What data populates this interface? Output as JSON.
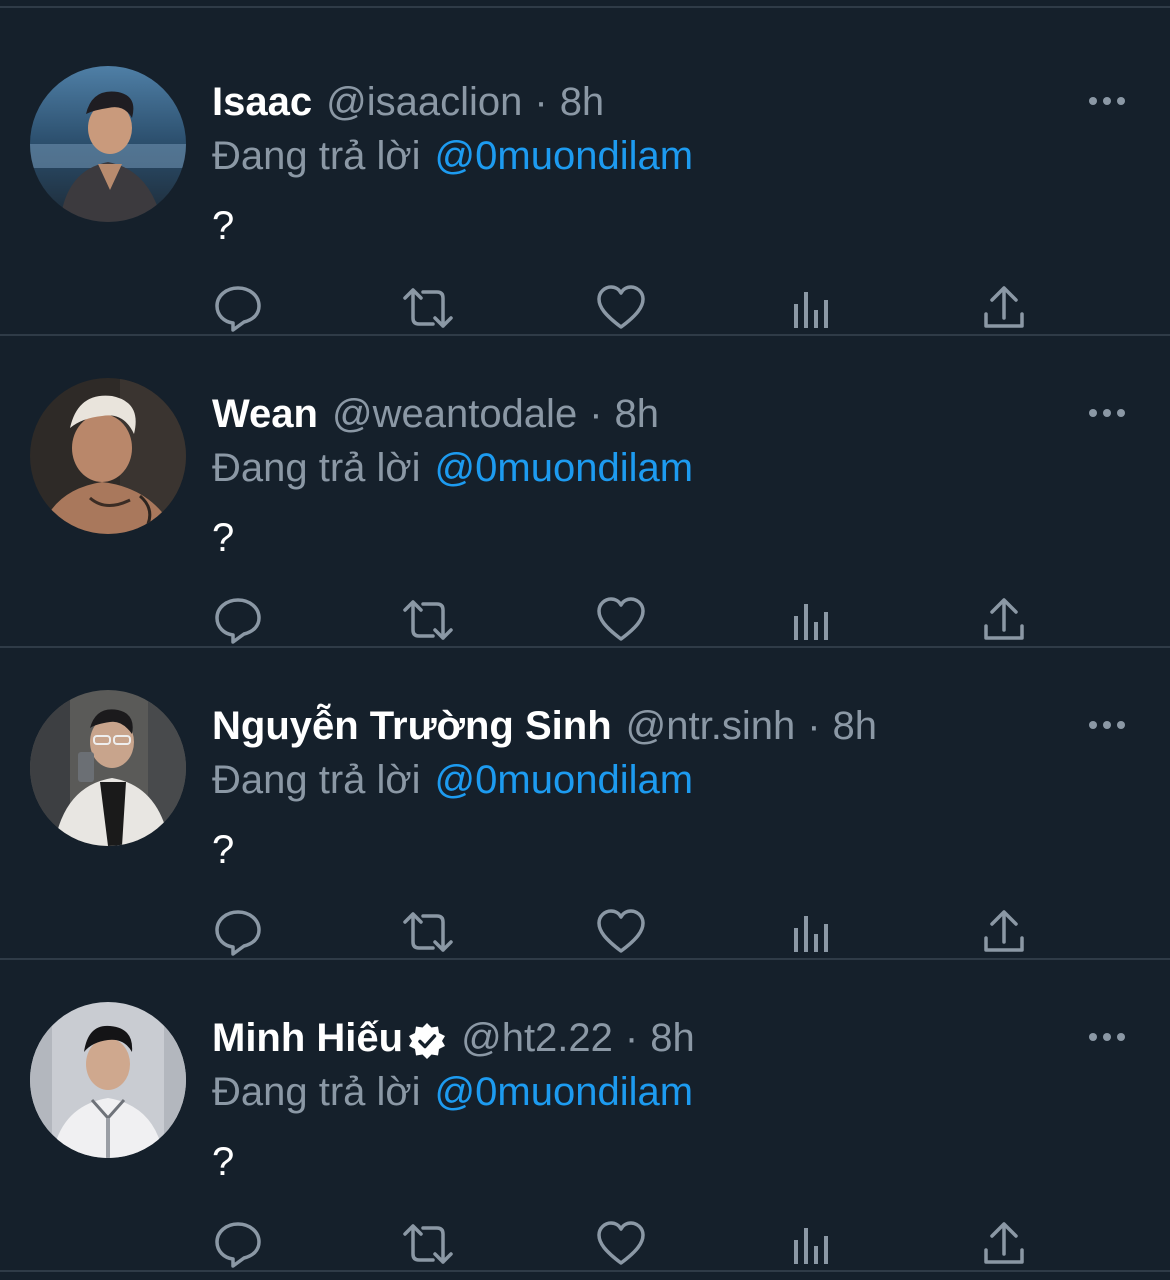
{
  "colors": {
    "background": "#15202b",
    "divider": "#2f3b47",
    "secondary_text": "#8b98a5",
    "mention": "#1d9bf0",
    "icon": "#8b98a5"
  },
  "tweets": [
    {
      "display_name": "Isaac",
      "handle": "@isaaclion",
      "dot": "·",
      "time": "8h",
      "verified": false,
      "reply_prefix": "Đang trả lời",
      "reply_mention": "@0muondilam",
      "text": "?"
    },
    {
      "display_name": "Wean",
      "handle": "@weantodale",
      "dot": "·",
      "time": "8h",
      "verified": false,
      "reply_prefix": "Đang trả lời",
      "reply_mention": "@0muondilam",
      "text": "?"
    },
    {
      "display_name": "Nguyễn Trường Sinh",
      "handle": "@ntr.sinh",
      "dot": "·",
      "time": "8h",
      "verified": false,
      "reply_prefix": "Đang trả lời",
      "reply_mention": "@0muondilam",
      "text": "?"
    },
    {
      "display_name": "Minh Hiếu",
      "handle": "@ht2.22",
      "dot": "·",
      "time": "8h",
      "verified": true,
      "reply_prefix": "Đang trả lời",
      "reply_mention": "@0muondilam",
      "text": "?"
    }
  ],
  "icons": {
    "more": "more-horizontal-icon",
    "reply": "reply-bubble-icon",
    "retweet": "retweet-icon",
    "like": "heart-icon",
    "analytics": "analytics-bars-icon",
    "share": "share-upload-icon",
    "verified": "verified-badge-icon"
  }
}
